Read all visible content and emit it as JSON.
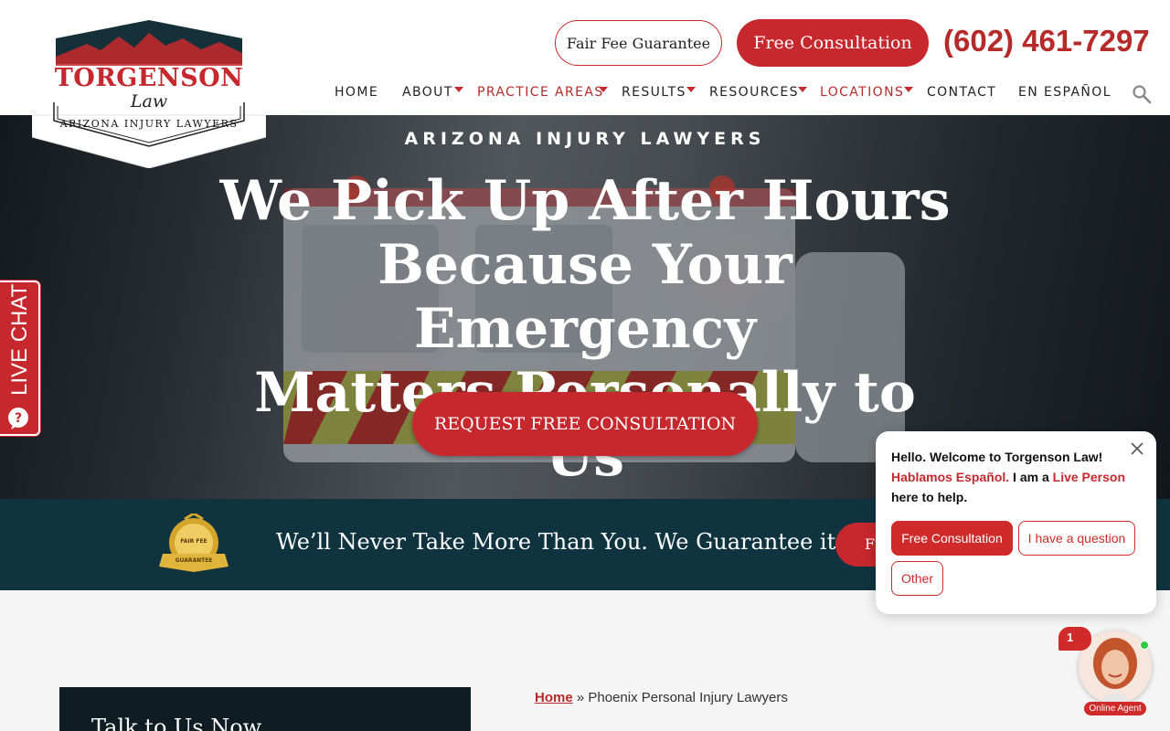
{
  "logo": {
    "title": "TORGENSON",
    "subtitle": "Law",
    "tagline": "ARIZONA INJURY LAWYERS"
  },
  "header": {
    "fair_fee_button": "Fair Fee Guarantee",
    "free_consult_button": "Free Consultation",
    "phone": "(602) 461-7297"
  },
  "nav": {
    "items": [
      {
        "label": "HOME",
        "dropdown": false,
        "highlight": false
      },
      {
        "label": "ABOUT",
        "dropdown": true,
        "highlight": false
      },
      {
        "label": "PRACTICE AREAS",
        "dropdown": true,
        "highlight": true
      },
      {
        "label": "RESULTS",
        "dropdown": true,
        "highlight": false
      },
      {
        "label": "RESOURCES",
        "dropdown": true,
        "highlight": false
      },
      {
        "label": "LOCATIONS",
        "dropdown": true,
        "highlight": true
      },
      {
        "label": "CONTACT",
        "dropdown": false,
        "highlight": false
      },
      {
        "label": "EN ESPAÑOL",
        "dropdown": false,
        "highlight": false
      }
    ],
    "search_icon": "search-icon"
  },
  "hero": {
    "eyebrow": "ARIZONA INJURY LAWYERS",
    "title_line1": "We Pick Up After Hours",
    "title_line2": "Because Your Emergency",
    "title_line3": "Matters Personally to Us",
    "cta": "REQUEST FREE CONSULTATION"
  },
  "live_chat_tab": {
    "label": "LIVE CHAT"
  },
  "band": {
    "badge_line1": "FAIR FEE",
    "badge_line2": "GUARANTEE",
    "text": "We’ll Never Take More Than You. We Guarantee it.",
    "button": "Fi"
  },
  "content": {
    "talk_title": "Talk to Us Now",
    "breadcrumb_home": "Home",
    "breadcrumb_sep": "»",
    "breadcrumb_current": "Phoenix Personal Injury Lawyers"
  },
  "chat_popup": {
    "greeting": "Hello. Welcome to Torgenson Law!",
    "spanish": "Hablamos Español.",
    "iam": "I am a",
    "live_person": "Live Person",
    "help": "here to help.",
    "buttons": [
      "Free Consultation",
      "I have a question",
      "Other"
    ]
  },
  "agent": {
    "badge_count": "1",
    "label": "Online Agent"
  },
  "colors": {
    "brand_red": "#c7282d",
    "band_bg": "#0f3440",
    "dark_box": "#0e1d24"
  }
}
